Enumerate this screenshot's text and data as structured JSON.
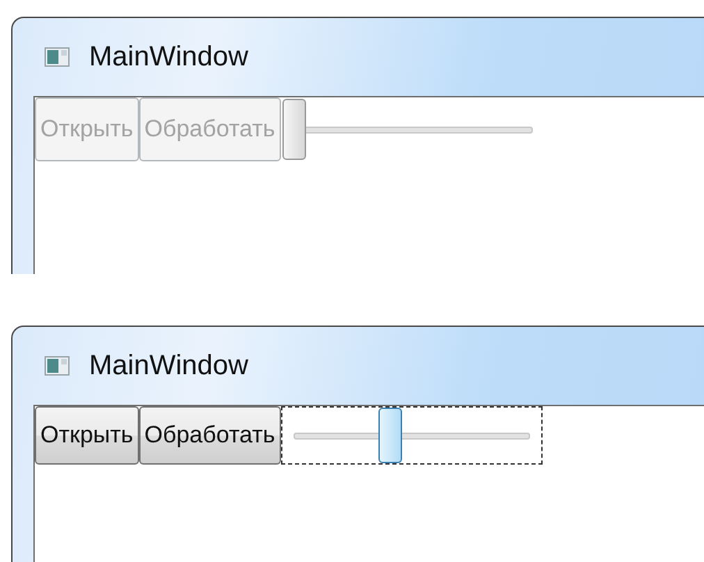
{
  "windows": [
    {
      "title": "MainWindow",
      "buttons": [
        {
          "label": "Открыть",
          "disabled": true
        },
        {
          "label": "Обработать",
          "disabled": true
        }
      ],
      "slider": {
        "level": 0,
        "disabled": true,
        "focused": false
      }
    },
    {
      "title": "MainWindow",
      "buttons": [
        {
          "label": "Открыть",
          "disabled": false
        },
        {
          "label": "Обработать",
          "disabled": false
        }
      ],
      "slider": {
        "level": 0.4,
        "disabled": false,
        "focused": true
      }
    }
  ]
}
